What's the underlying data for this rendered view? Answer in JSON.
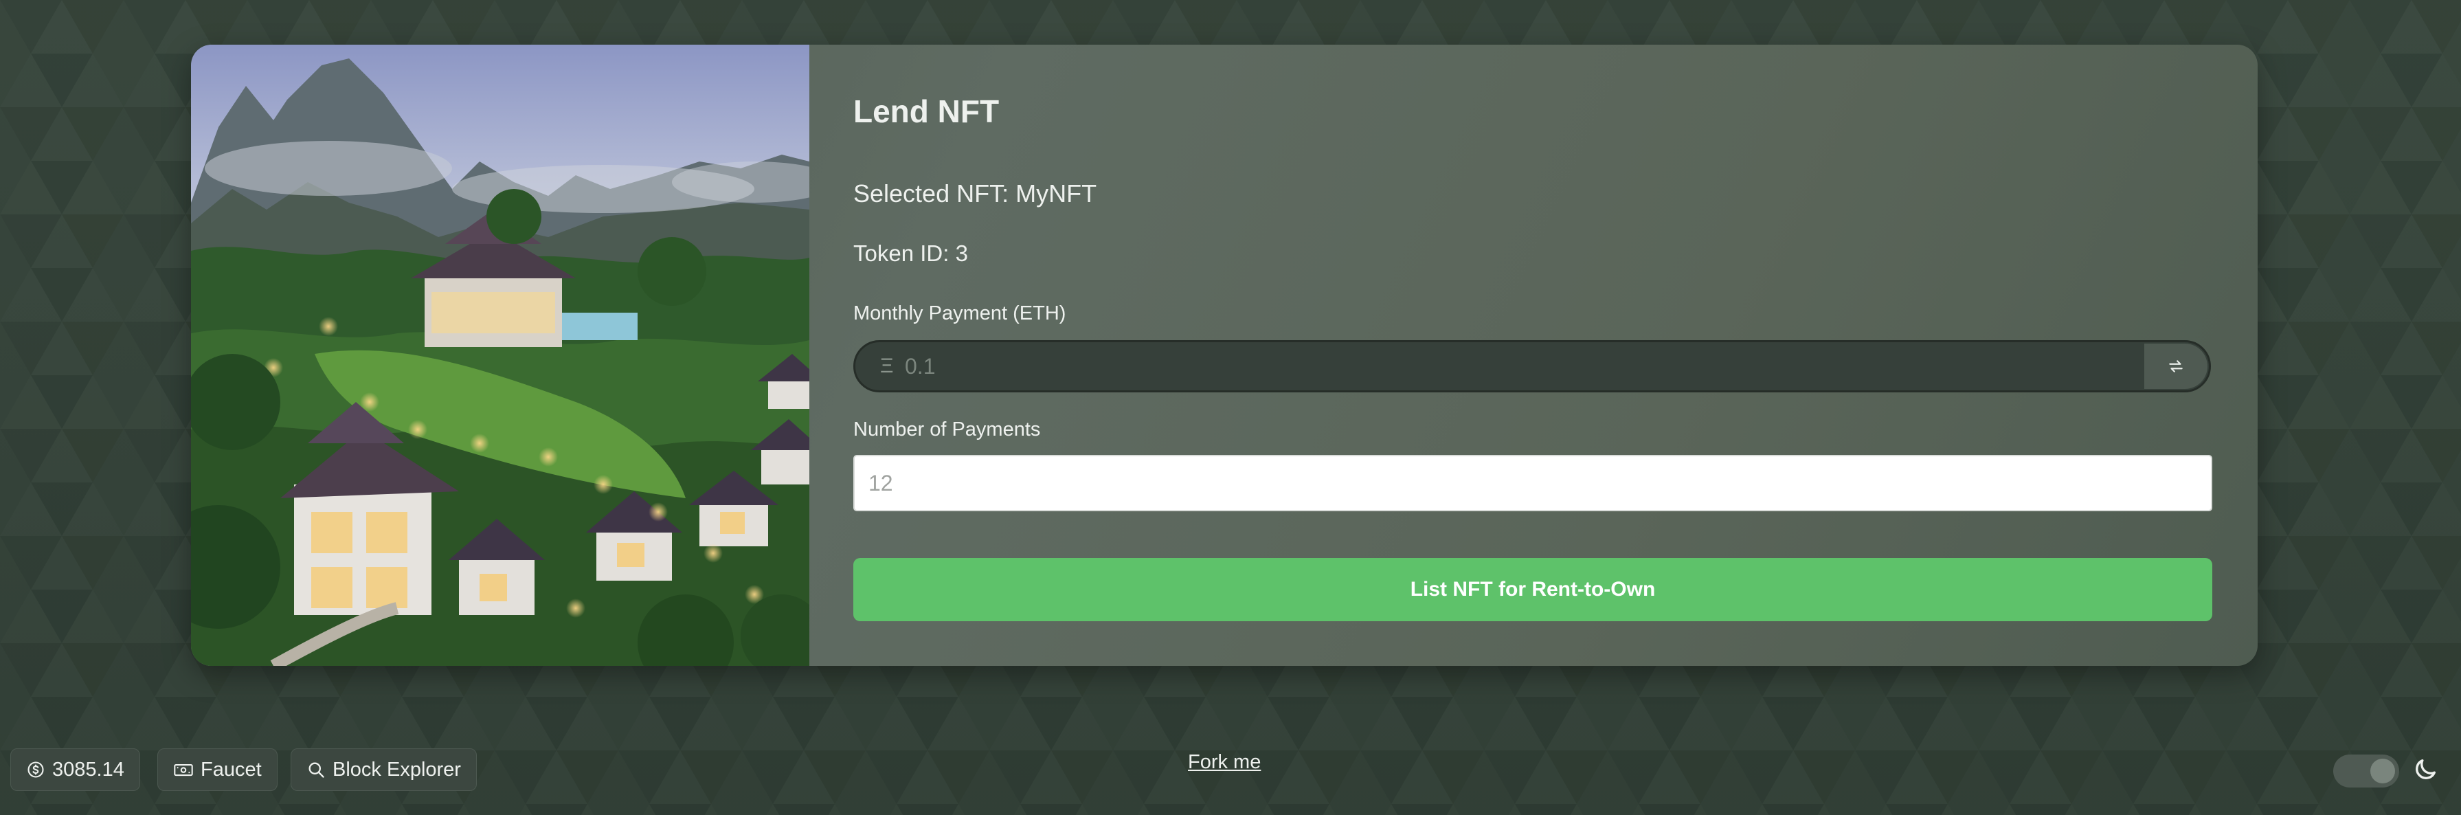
{
  "page": {
    "background_color": "#3a4a40"
  },
  "lend_card": {
    "title": "Lend NFT",
    "selected_nft": "Selected NFT: MyNFT",
    "token_id": "Token ID: 3",
    "image": "nft-property-image",
    "monthly_payment": {
      "label": "Monthly Payment (ETH)",
      "currency_symbol": "Ξ",
      "placeholder": "0.1",
      "value": "",
      "swap_icon": "swap-arrows-icon"
    },
    "number_of_payments": {
      "label": "Number of Payments",
      "placeholder": "12",
      "value": ""
    },
    "submit_label": "List NFT for Rent-to-Own",
    "accent_color": "#5ec26a"
  },
  "footer": {
    "price_label": "3085.14",
    "price_icon": "dollar-circle-icon",
    "faucet_label": "Faucet",
    "faucet_icon": "banknote-icon",
    "explorer_label": "Block Explorer",
    "explorer_icon": "search-icon",
    "fork_label": "Fork me",
    "theme_toggle_icon": "moon-icon"
  }
}
